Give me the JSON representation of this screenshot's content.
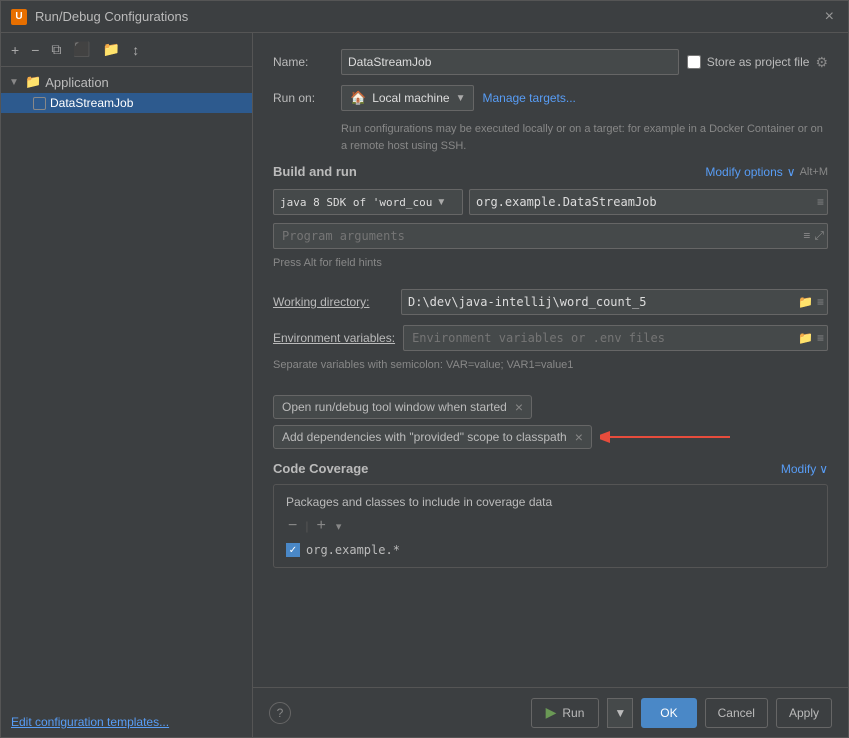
{
  "titleBar": {
    "icon": "U",
    "title": "Run/Debug Configurations",
    "closeLabel": "×"
  },
  "leftPanel": {
    "toolbar": {
      "addLabel": "+",
      "removeLabel": "−",
      "copyLabel": "⧉",
      "saveLabel": "⬛",
      "folderLabel": "📁",
      "sortLabel": "↕"
    },
    "tree": {
      "applicationLabel": "Application",
      "configName": "DataStreamJob"
    },
    "editTemplates": "Edit configuration templates..."
  },
  "rightPanel": {
    "name": {
      "label": "Name:",
      "value": "DataStreamJob"
    },
    "storeProject": {
      "label": "Store as project file",
      "checked": false
    },
    "runOn": {
      "label": "Run on:",
      "houseIcon": "🏠",
      "value": "Local machine",
      "manageTargets": "Manage targets..."
    },
    "runHint": "Run configurations may be executed locally or on a target: for example in a Docker Container or on a remote host using SSH.",
    "buildAndRun": {
      "title": "Build and run",
      "modifyOptions": "Modify options",
      "modifyArrow": "∨",
      "shortcut": "Alt+M"
    },
    "sdk": {
      "value": "java 8 SDK of 'word_cou",
      "dropdownArrow": "▼"
    },
    "mainClass": {
      "value": "org.example.DataStreamJob",
      "iconLabel": "≡"
    },
    "programArgs": {
      "placeholder": "Program arguments",
      "iconExpand": "⤢",
      "iconList": "≡"
    },
    "altHint": "Press Alt for field hints",
    "workingDirectory": {
      "label": "Working directory:",
      "value": "D:\\dev\\java-intellij\\word_count_5",
      "folderIcon": "📁",
      "listIcon": "≡"
    },
    "envVariables": {
      "label": "Environment variables:",
      "placeholder": "Environment variables or .env files",
      "folderIcon": "📁",
      "listIcon": "≡"
    },
    "envHint": "Separate variables with semicolon: VAR=value; VAR1=value1",
    "tags": [
      {
        "label": "Open run/debug tool window when started",
        "closeLabel": "×"
      },
      {
        "label": "Add dependencies with \"provided\" scope to classpath",
        "closeLabel": "×"
      }
    ],
    "codeCoverage": {
      "title": "Code Coverage",
      "modifyLabel": "Modify",
      "modifyArrow": "∨",
      "desc": "Packages and classes to include in coverage data",
      "toolbarMinus": "−",
      "toolbarPlus": "+",
      "packageItem": "org.example.*",
      "itemChecked": true
    }
  },
  "bottomBar": {
    "helpLabel": "?",
    "runLabel": "Run",
    "runArrow": "▶",
    "runDropdown": "▼",
    "okLabel": "OK",
    "cancelLabel": "Cancel",
    "applyLabel": "Apply"
  }
}
